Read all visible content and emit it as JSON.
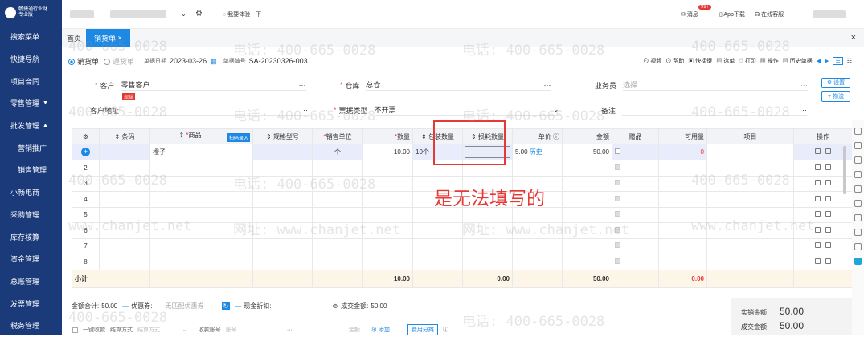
{
  "brand": {
    "name": "畅捷通行业财",
    "edition": "专业版"
  },
  "sidebar": {
    "items": [
      "搜索菜单",
      "快捷导航",
      "项目合同",
      "零售管理",
      "批发管理",
      "营销推广",
      "销售管理",
      "小畅电商",
      "采购管理",
      "库存核算",
      "资金管理",
      "总账管理",
      "发票管理",
      "税务管理"
    ]
  },
  "topbar": {
    "try_label": "我要体验一下",
    "msg_badge": "99+",
    "msg_label": "消息",
    "app_label": "App下载",
    "service_label": "在线客服"
  },
  "tabs": {
    "home": "首页",
    "active": "销货单",
    "close": "×"
  },
  "window_close": "×",
  "toolrow": {
    "radio1": "销货单",
    "radio2": "退货单",
    "date_label": "单据日期",
    "date_value": "2023-03-26",
    "code_label": "单据编号",
    "code_value": "SA-20230326-003",
    "actions": [
      "视频",
      "帮助",
      "快捷键",
      "选单",
      "打印",
      "操作",
      "历史单据"
    ]
  },
  "form": {
    "customer_label": "客户",
    "customer_value": "零售客户",
    "customer_tag": "现结",
    "warehouse_label": "仓库",
    "warehouse_value": "总仓",
    "salesman_label": "业务员",
    "salesman_placeholder": "选择...",
    "address_label": "客户地址",
    "invoice_label": "票据类型",
    "invoice_value": "不开票",
    "remark_label": "备注",
    "settings_btn": "设置",
    "logistics_btn": "+ 物流"
  },
  "table": {
    "headers": [
      "条码",
      "商品",
      "扫码录入",
      "规格型号",
      "销售单位",
      "数量",
      "包装数量",
      "损耗数量",
      "单价",
      "金额",
      "赠品",
      "可用量",
      "项目",
      "操作"
    ],
    "row1": {
      "product": "橙子",
      "unit": "个",
      "qty": "10.00",
      "pack": "10个",
      "price": "5.00",
      "history": "历史",
      "amount": "50.00",
      "avail": "0"
    },
    "row_numbers": [
      "2",
      "3",
      "4",
      "5",
      "6",
      "7",
      "8"
    ],
    "subtotal": {
      "label": "小计",
      "qty": "10.00",
      "loss": "0.00",
      "amount": "50.00",
      "avail": "0.00"
    }
  },
  "annotation": "是无法填写的",
  "bottom": {
    "total_label": "金额合计:",
    "total_value": "50.00",
    "coupon_label": "优惠券:",
    "coupon_value": "无匹配优惠券",
    "discount_label": "现金折扣:",
    "deal_label": "成交金额:",
    "deal_value": "50.00",
    "one_click": "一键收款",
    "settle_label": "结算方式",
    "settle_ph": "结算方式",
    "account_label": "收款账号",
    "account_ph": "账号",
    "amount_label": "金额",
    "add_label": "添加",
    "fee_btn": "费用分摊"
  },
  "totals": {
    "actual_label": "实销金额",
    "actual_value": "50.00",
    "deal_label": "成交金额",
    "deal_value": "50.00"
  },
  "watermark": {
    "phone": "电话: 400-665-0028",
    "site": "网址: www.chanjet.net",
    "phone_short": "400-665-0028",
    "site_short": "www.chanjet.net"
  },
  "colors": {
    "sidebar": "#1a3a7a",
    "accent": "#1e88e5",
    "annotation": "#e53935"
  }
}
